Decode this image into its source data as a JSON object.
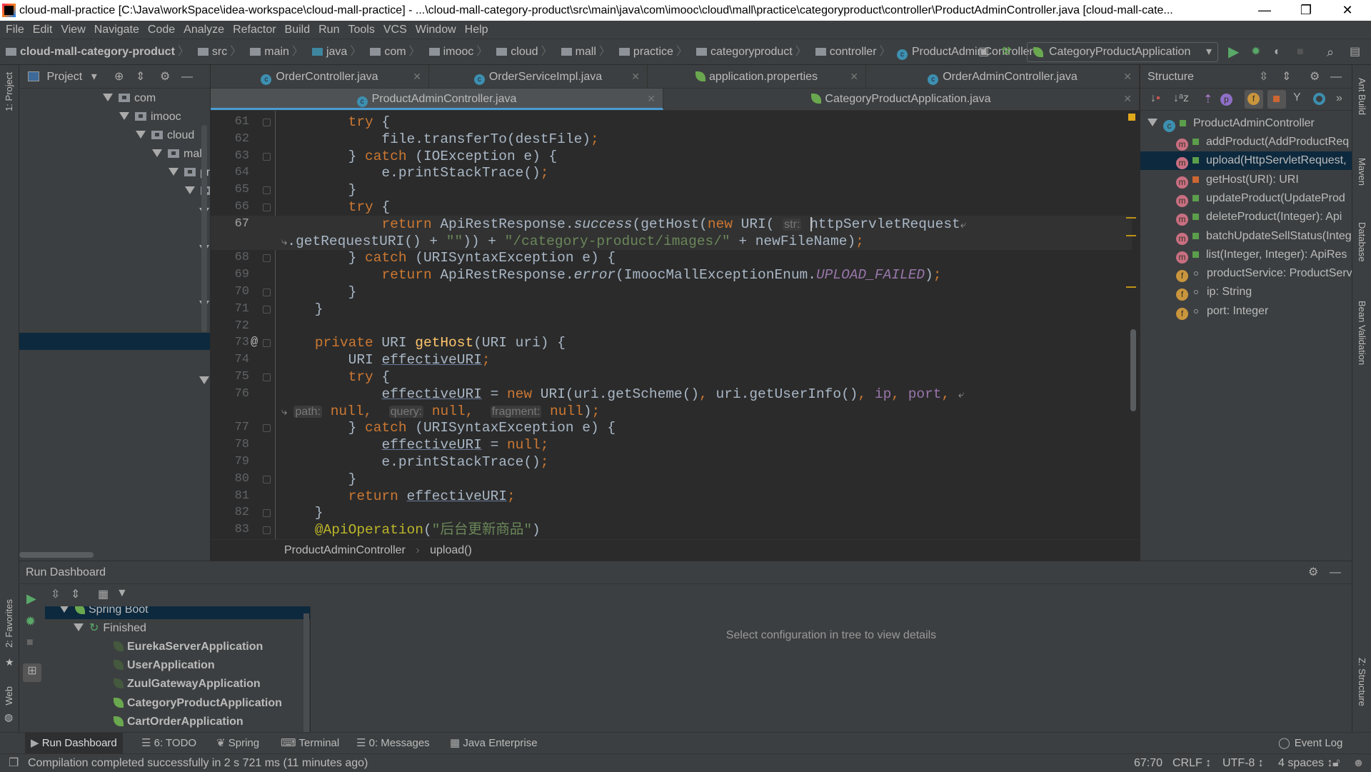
{
  "window": {
    "title": "cloud-mall-practice [C:\\Java\\workSpace\\idea-workspace\\cloud-mall-practice] - ...\\cloud-mall-category-product\\src\\main\\java\\com\\imooc\\cloud\\mall\\practice\\categoryproduct\\controller\\ProductAdminController.java [cloud-mall-cate...",
    "minimize": "—",
    "restore": "❐",
    "close": "✕"
  },
  "menu": [
    "File",
    "Edit",
    "View",
    "Navigate",
    "Code",
    "Analyze",
    "Refactor",
    "Build",
    "Run",
    "Tools",
    "VCS",
    "Window",
    "Help"
  ],
  "nav": {
    "crumbs": [
      "cloud-mall-category-product",
      "src",
      "main",
      "java",
      "com",
      "imooc",
      "cloud",
      "mall",
      "practice",
      "categoryproduct",
      "controller"
    ],
    "class_crumb": "ProductAdminController",
    "run_config": "CategoryProductApplication"
  },
  "left_strip": {
    "project": "1: Project",
    "favorites": "2: Favorites",
    "web": "Web"
  },
  "right_strip": {
    "ant": "Ant Build",
    "maven": "Maven",
    "database": "Database",
    "bean": "Bean Validation",
    "zstructure": "Z: Structure"
  },
  "project": {
    "title": "Project",
    "tree": [
      {
        "label": "com",
        "depth": 0
      },
      {
        "label": "imooc",
        "depth": 1
      },
      {
        "label": "cloud",
        "depth": 2
      },
      {
        "label": "mall",
        "depth": 3
      },
      {
        "label": "pr",
        "depth": 4
      },
      {
        "label": "",
        "depth": 5
      }
    ]
  },
  "editor": {
    "tabs_row1": [
      {
        "label": "OrderController.java",
        "icon": "class"
      },
      {
        "label": "OrderServiceImpl.java",
        "icon": "class"
      },
      {
        "label": "application.properties",
        "icon": "spring-leaf"
      },
      {
        "label": "OrderAdminController.java",
        "icon": "class"
      }
    ],
    "tabs_row2": [
      {
        "label": "ProductAdminController.java",
        "icon": "class",
        "active": true
      },
      {
        "label": "CategoryProductApplication.java",
        "icon": "spring-boot"
      }
    ],
    "current_line": "67",
    "code": [
      {
        "n": "61",
        "fold": true,
        "t": [
          [
            "        ",
            ""
          ],
          [
            "try",
            "kw"
          ],
          [
            " {",
            ""
          ]
        ]
      },
      {
        "n": "62",
        "t": [
          [
            "            file.transferTo(destFile)",
            ""
          ],
          [
            ";",
            "kw"
          ]
        ]
      },
      {
        "n": "63",
        "fold": true,
        "t": [
          [
            "        } ",
            ""
          ],
          [
            "catch",
            "kw"
          ],
          [
            " (IOException e) {",
            ""
          ]
        ]
      },
      {
        "n": "64",
        "t": [
          [
            "            e.printStackTrace()",
            ""
          ],
          [
            ";",
            "kw"
          ]
        ]
      },
      {
        "n": "65",
        "fold": true,
        "t": [
          [
            "        }",
            ""
          ]
        ]
      },
      {
        "n": "66",
        "fold": true,
        "t": [
          [
            "        ",
            ""
          ],
          [
            "try",
            "kw"
          ],
          [
            " {",
            ""
          ]
        ]
      },
      {
        "n": "67",
        "cur": true,
        "t": [
          [
            "            ",
            ""
          ],
          [
            "return",
            "kw"
          ],
          [
            " ApiRestResponse.",
            ""
          ],
          [
            "success",
            "fn"
          ],
          [
            "(getHost(",
            ""
          ],
          [
            "new",
            "kw"
          ],
          [
            " URI( ",
            ""
          ],
          [
            "str:",
            "hint"
          ],
          [
            " httpServletRequest",
            ""
          ],
          [
            "⤶",
            "wrapm"
          ]
        ]
      },
      {
        "n": "",
        "cur": true,
        "t": [
          [
            "⤷",
            "wrapm"
          ],
          [
            ".getRequestURI() + ",
            ""
          ],
          [
            "\"\"",
            "str"
          ],
          [
            ")) + ",
            ""
          ],
          [
            "\"/category-product/images/\"",
            "str"
          ],
          [
            " + newFileName)",
            ""
          ],
          [
            ";",
            "kw"
          ]
        ]
      },
      {
        "n": "68",
        "fold": true,
        "t": [
          [
            "        } ",
            ""
          ],
          [
            "catch",
            "kw"
          ],
          [
            " (URISyntaxException e) {",
            ""
          ]
        ]
      },
      {
        "n": "69",
        "t": [
          [
            "            ",
            ""
          ],
          [
            "return",
            "kw"
          ],
          [
            " ApiRestResponse.",
            ""
          ],
          [
            "error",
            "fn"
          ],
          [
            "(ImoocMallExceptionEnum.",
            ""
          ],
          [
            "UPLOAD_FAILED",
            "cst"
          ],
          [
            ")",
            ""
          ],
          [
            ";",
            "kw"
          ]
        ]
      },
      {
        "n": "70",
        "fold": true,
        "t": [
          [
            "        }",
            ""
          ]
        ]
      },
      {
        "n": "71",
        "fold": true,
        "t": [
          [
            "    }",
            ""
          ]
        ]
      },
      {
        "n": "72",
        "t": []
      },
      {
        "n": "73",
        "fold": true,
        "at": "@",
        "t": [
          [
            "    ",
            ""
          ],
          [
            "private",
            "kw"
          ],
          [
            " URI ",
            ""
          ],
          [
            "getHost",
            "mdecl"
          ],
          [
            "(URI uri) {",
            ""
          ]
        ]
      },
      {
        "n": "74",
        "t": [
          [
            "        URI ",
            ""
          ],
          [
            "effectiveURI",
            "ul"
          ],
          [
            ";",
            "kw"
          ]
        ]
      },
      {
        "n": "75",
        "fold": true,
        "t": [
          [
            "        ",
            ""
          ],
          [
            "try",
            "kw"
          ],
          [
            " {",
            ""
          ]
        ]
      },
      {
        "n": "76",
        "t": [
          [
            "            ",
            ""
          ],
          [
            "effectiveURI",
            "ul"
          ],
          [
            " = ",
            ""
          ],
          [
            "new",
            "kw"
          ],
          [
            " URI(uri.getScheme()",
            ""
          ],
          [
            ", ",
            "kw"
          ],
          [
            "uri.getUserInfo()",
            ""
          ],
          [
            ", ",
            "kw"
          ],
          [
            "ip",
            "fld"
          ],
          [
            ", ",
            "kw"
          ],
          [
            "port",
            "fld"
          ],
          [
            ", ",
            "kw"
          ],
          [
            "⤶",
            "wrapm"
          ]
        ]
      },
      {
        "n": "",
        "t": [
          [
            "⤷ ",
            "wrapm"
          ],
          [
            "path:",
            "hint"
          ],
          [
            " ",
            ""
          ],
          [
            "null",
            "kw"
          ],
          [
            ",  ",
            "kw"
          ],
          [
            "query:",
            "hint"
          ],
          [
            " ",
            ""
          ],
          [
            "null",
            "kw"
          ],
          [
            ",  ",
            "kw"
          ],
          [
            "fragment:",
            "hint"
          ],
          [
            " ",
            ""
          ],
          [
            "null",
            "kw"
          ],
          [
            ")",
            ""
          ],
          [
            ";",
            "kw"
          ]
        ]
      },
      {
        "n": "77",
        "fold": true,
        "t": [
          [
            "        } ",
            ""
          ],
          [
            "catch",
            "kw"
          ],
          [
            " (URISyntaxException e) {",
            ""
          ]
        ]
      },
      {
        "n": "78",
        "t": [
          [
            "            ",
            ""
          ],
          [
            "effectiveURI",
            "ul"
          ],
          [
            " = ",
            ""
          ],
          [
            "null",
            "kw"
          ],
          [
            ";",
            "kw"
          ]
        ]
      },
      {
        "n": "79",
        "t": [
          [
            "            e.printStackTrace()",
            ""
          ],
          [
            ";",
            "kw"
          ]
        ]
      },
      {
        "n": "80",
        "fold": true,
        "t": [
          [
            "        }",
            ""
          ]
        ]
      },
      {
        "n": "81",
        "t": [
          [
            "        ",
            ""
          ],
          [
            "return",
            "kw"
          ],
          [
            " ",
            ""
          ],
          [
            "effectiveURI",
            "ul"
          ],
          [
            ";",
            "kw"
          ]
        ]
      },
      {
        "n": "82",
        "fold": true,
        "t": [
          [
            "    }",
            ""
          ]
        ]
      },
      {
        "n": "83",
        "fold": true,
        "t": [
          [
            "    ",
            ""
          ],
          [
            "@ApiOperation",
            "ann"
          ],
          [
            "(",
            ""
          ],
          [
            "\"后台更新商品\"",
            "str"
          ],
          [
            ")",
            ""
          ]
        ]
      }
    ],
    "breadcrumb": {
      "class": "ProductAdminController",
      "method": "upload()"
    }
  },
  "structure": {
    "title": "Structure",
    "root": "ProductAdminController",
    "items": [
      {
        "kind": "m",
        "access": "public",
        "label": "addProduct(AddProductReq"
      },
      {
        "kind": "m",
        "access": "public",
        "label": "upload(HttpServletRequest,",
        "selected": true
      },
      {
        "kind": "m",
        "access": "private",
        "label": "getHost(URI): URI"
      },
      {
        "kind": "m",
        "access": "public",
        "label": "updateProduct(UpdateProd"
      },
      {
        "kind": "m",
        "access": "public",
        "label": "deleteProduct(Integer): Api"
      },
      {
        "kind": "m",
        "access": "public",
        "label": "batchUpdateSellStatus(Integ"
      },
      {
        "kind": "m",
        "access": "public",
        "label": "list(Integer, Integer): ApiRes"
      },
      {
        "kind": "f",
        "access": "package",
        "label": "productService: ProductServ"
      },
      {
        "kind": "f",
        "access": "package",
        "label": "ip: String"
      },
      {
        "kind": "f",
        "access": "package",
        "label": "port: Integer"
      }
    ]
  },
  "run_dashboard": {
    "title": "Run Dashboard",
    "group": "Spring Boot",
    "status": "Finished",
    "apps": [
      {
        "label": "EurekaServerApplication",
        "active": false
      },
      {
        "label": "UserApplication",
        "active": false
      },
      {
        "label": "ZuulGatewayApplication",
        "active": false
      },
      {
        "label": "CategoryProductApplication",
        "active": true
      },
      {
        "label": "CartOrderApplication",
        "active": true
      }
    ],
    "empty_message": "Select configuration in tree to view details"
  },
  "bottom_tabs": [
    "Run Dashboard",
    "6: TODO",
    "Spring",
    "Terminal",
    "0: Messages",
    "Java Enterprise"
  ],
  "event_log": "Event Log",
  "status": {
    "message": "Compilation completed successfully in 2 s 721 ms (11 minutes ago)",
    "position": "67:70",
    "line_sep": "CRLF ↕",
    "encoding": "UTF-8 ↕",
    "indent": "4 spaces ↕"
  },
  "colors": {
    "keyword": "#cc7832",
    "string": "#6a8759",
    "field": "#9876aa",
    "annotation": "#bbb529",
    "editor_bg": "#2b2b2b",
    "panel_bg": "#3c3f41",
    "selection": "#0d293e",
    "accent": "#4a9bd1"
  }
}
